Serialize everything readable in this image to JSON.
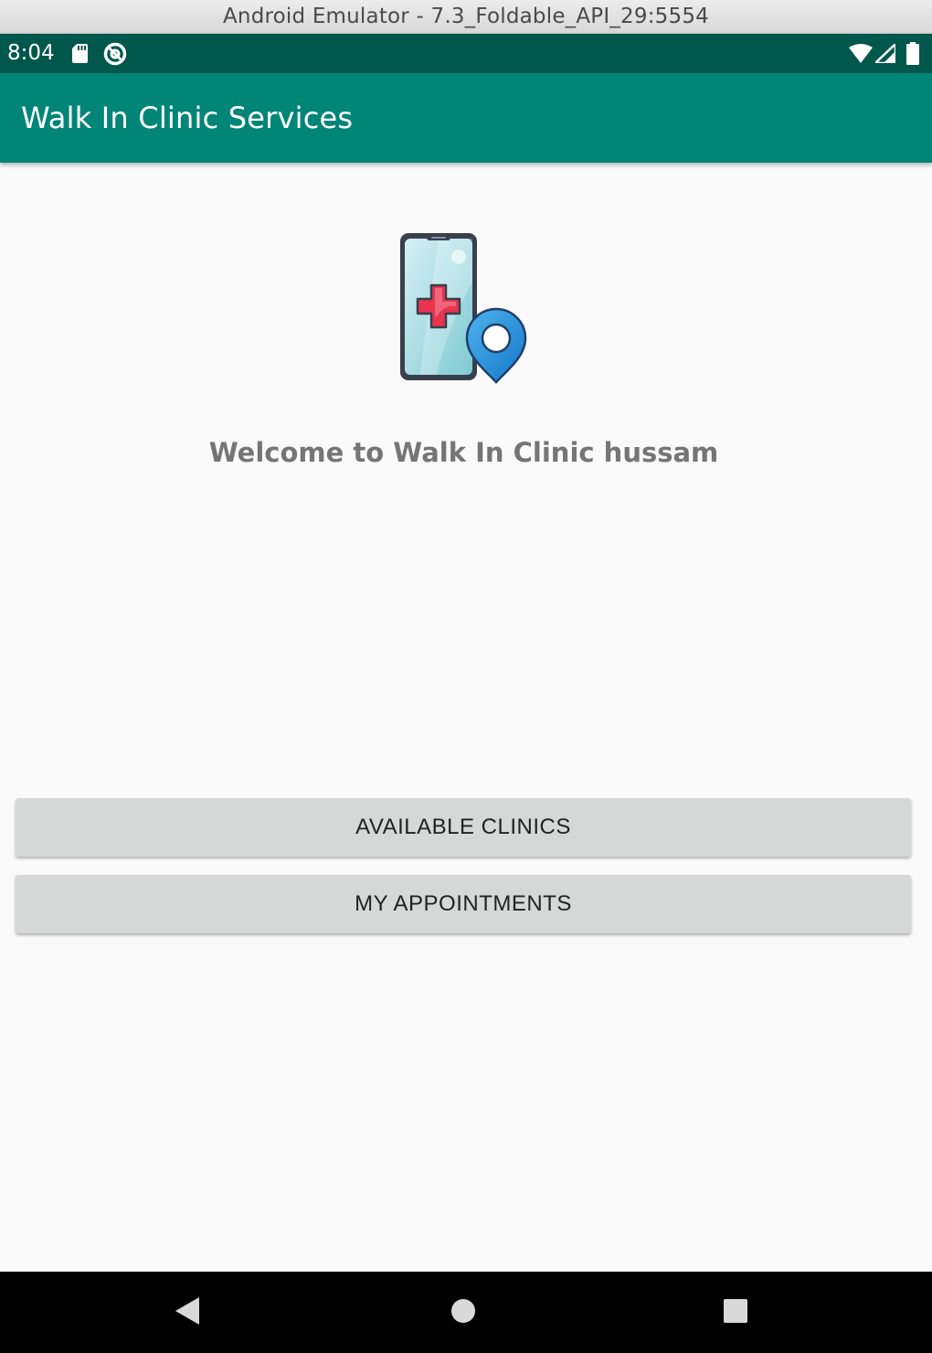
{
  "window": {
    "title": "Android Emulator - 7.3_Foldable_API_29:5554"
  },
  "status_bar": {
    "time": "8:04",
    "left_icons": [
      "sd-card-icon",
      "data-saver-icon"
    ],
    "right_icons": [
      "wifi-icon",
      "signal-icon",
      "battery-icon"
    ],
    "background": "#00574b"
  },
  "app_bar": {
    "title": "Walk In Clinic Services",
    "background": "#008577"
  },
  "main": {
    "logo_icon": "clinic-phone-location-icon",
    "welcome_text": "Welcome to Walk In Clinic hussam",
    "buttons": {
      "available_clinics": "AVAILABLE CLINICS",
      "my_appointments": "MY APPOINTMENTS"
    }
  },
  "nav_bar": {
    "icons": [
      "back-icon",
      "home-icon",
      "recents-icon"
    ]
  }
}
